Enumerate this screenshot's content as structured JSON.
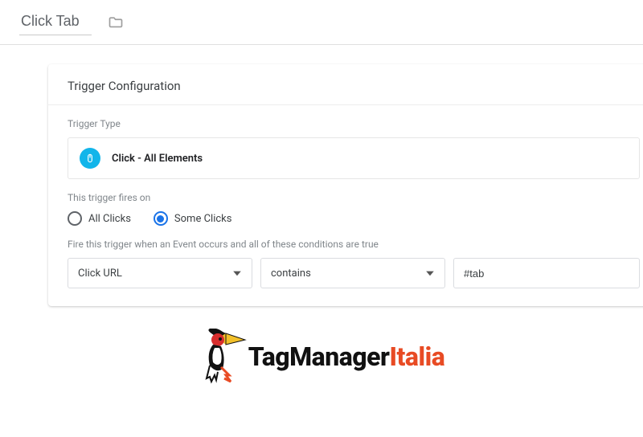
{
  "header": {
    "title": "Click Tab"
  },
  "card": {
    "heading": "Trigger Configuration",
    "triggerTypeLabel": "Trigger Type",
    "triggerTypeName": "Click - All Elements",
    "firesOnLabel": "This trigger fires on",
    "radios": {
      "all": "All Clicks",
      "some": "Some Clicks"
    },
    "conditionLabel": "Fire this trigger when an Event occurs and all of these conditions are true",
    "condition": {
      "variable": "Click URL",
      "operator": "contains",
      "value": "#tab"
    }
  },
  "logo": {
    "part1": "TagManager",
    "part2": "Italia"
  }
}
